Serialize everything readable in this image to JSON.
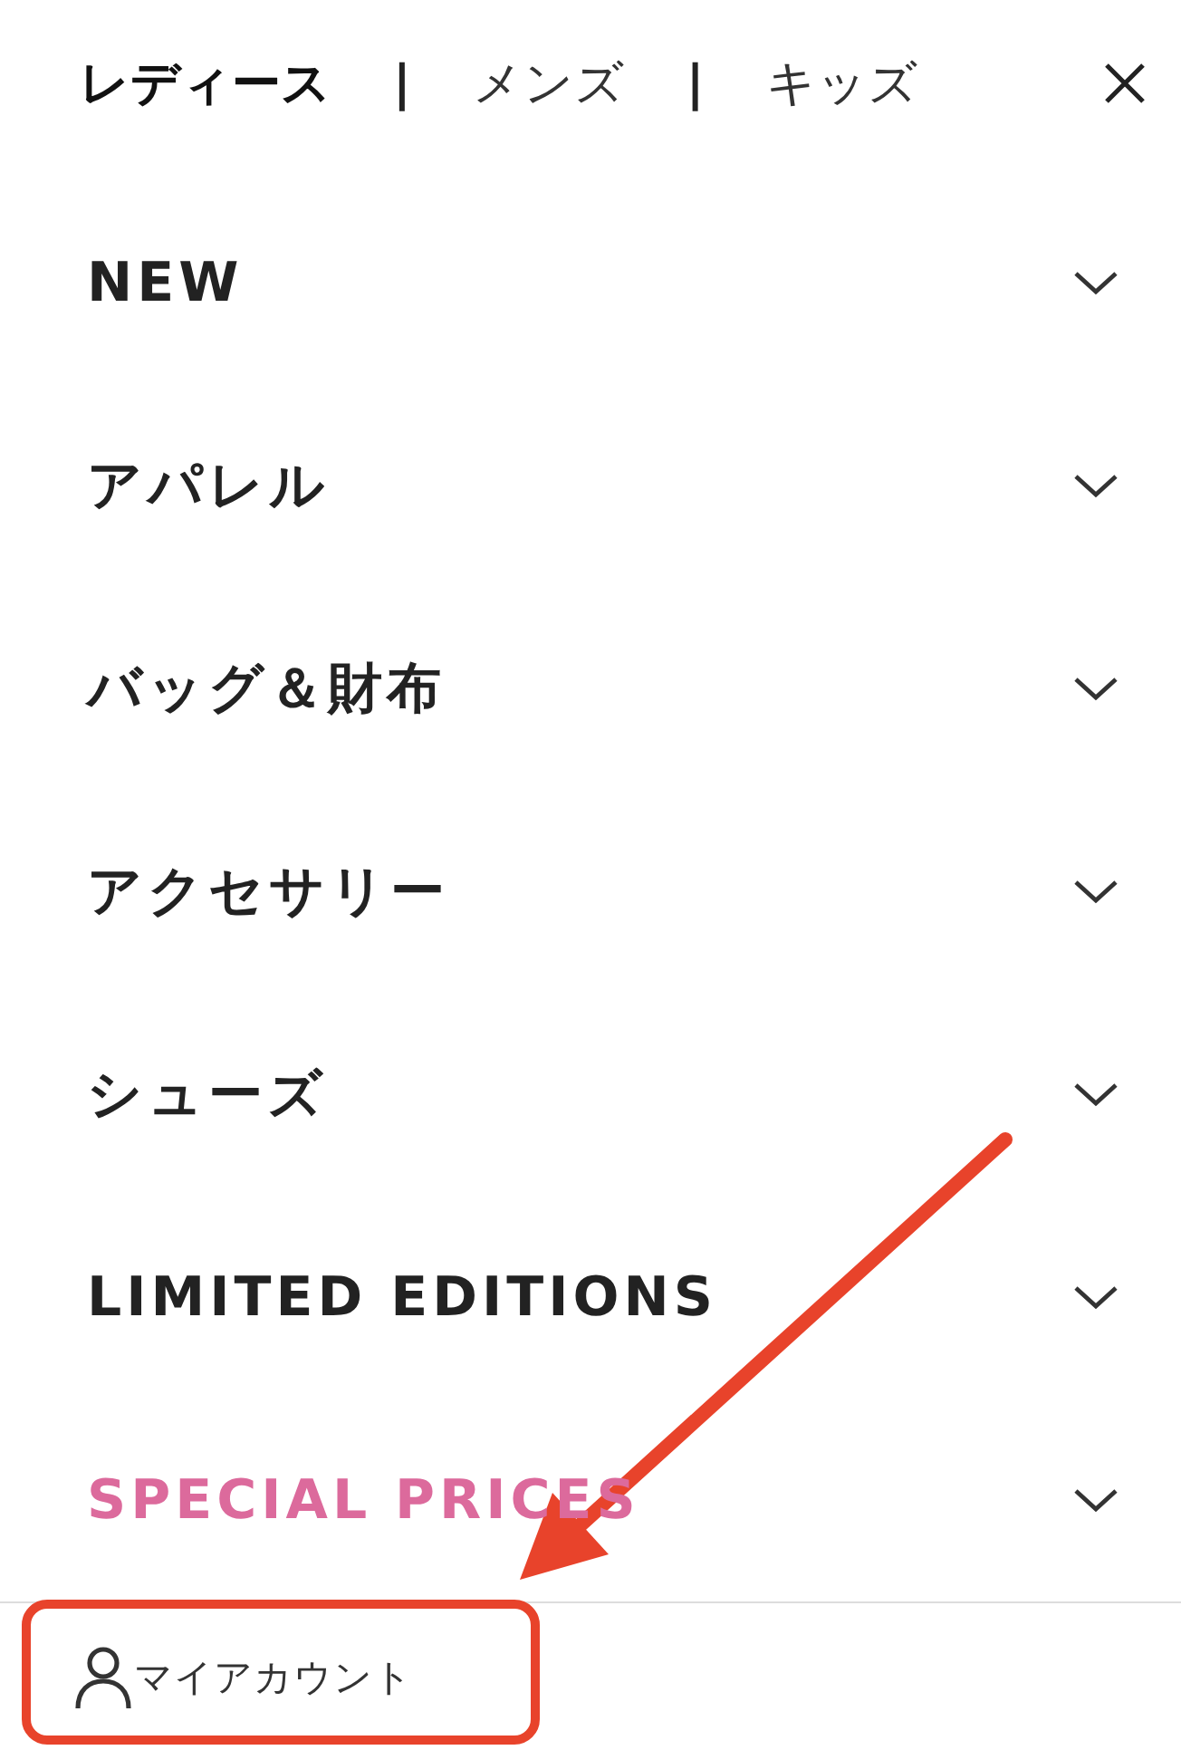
{
  "header": {
    "items": [
      {
        "kind": "tab",
        "label": "レディース",
        "selected": true
      },
      {
        "kind": "separator",
        "label": "|"
      },
      {
        "kind": "tab",
        "label": "メンズ",
        "selected": false
      },
      {
        "kind": "separator",
        "label": "|"
      },
      {
        "kind": "tab",
        "label": "キッズ",
        "selected": false
      }
    ]
  },
  "menu": [
    {
      "label": "NEW",
      "color": "#222222",
      "expanded": false
    },
    {
      "label": "アパレル",
      "color": "#222222",
      "expanded": false
    },
    {
      "label": "バッグ＆財布",
      "color": "#222222",
      "expanded": false
    },
    {
      "label": "アクセサリー",
      "color": "#222222",
      "expanded": false
    },
    {
      "label": "シューズ",
      "color": "#222222",
      "expanded": false
    },
    {
      "label": "LIMITED EDITIONS",
      "color": "#222222",
      "expanded": false
    },
    {
      "label": "SPECIAL PRICES",
      "color": "#dc6a9c",
      "expanded": false
    }
  ],
  "account": {
    "label": "マイアカウント"
  },
  "annotation": {
    "kind": "arrow-and-box"
  }
}
